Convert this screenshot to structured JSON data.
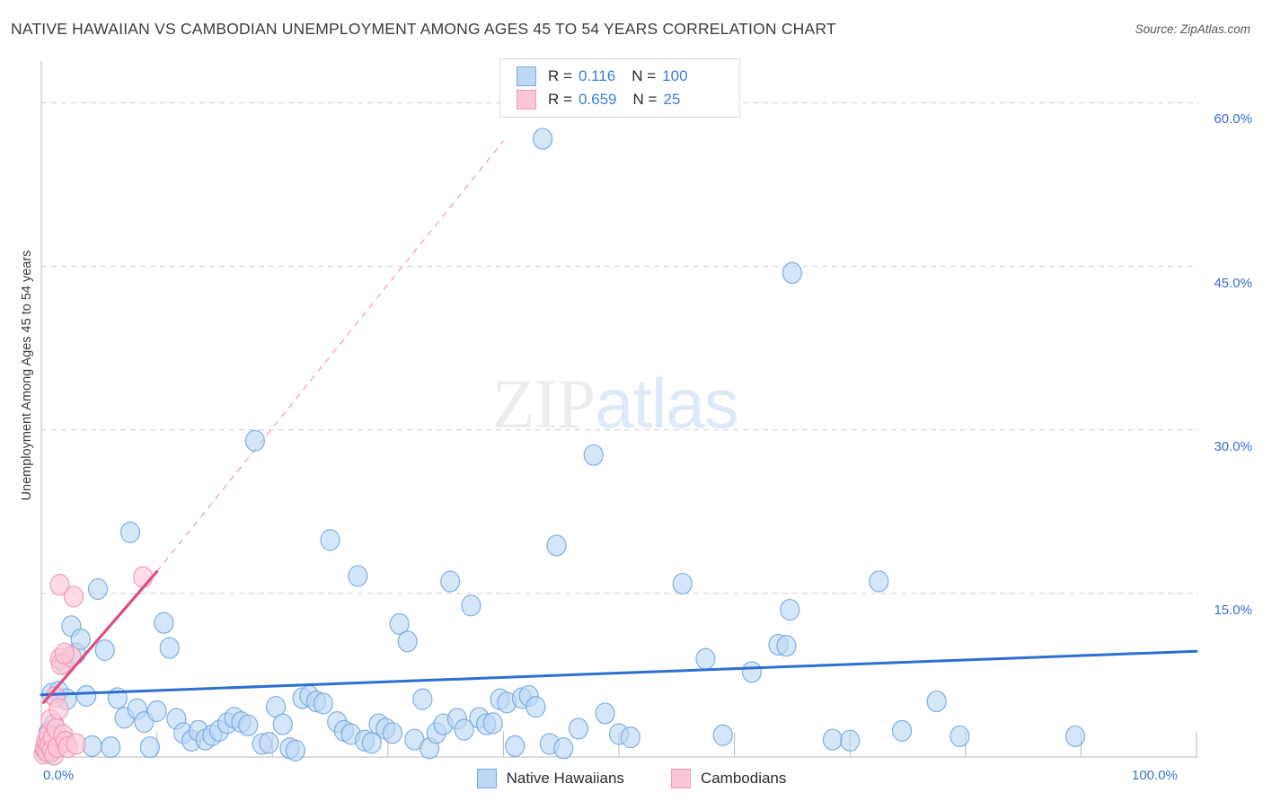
{
  "header": {
    "title": "NATIVE HAWAIIAN VS CAMBODIAN UNEMPLOYMENT AMONG AGES 45 TO 54 YEARS CORRELATION CHART",
    "source": "Source: ZipAtlas.com"
  },
  "watermark": {
    "part1": "ZIP",
    "part2": "atlas"
  },
  "legend_box": {
    "rows": [
      {
        "color": "#bdd7f5",
        "r_label": "R =",
        "r_value": "0.116",
        "n_label": "N =",
        "n_value": "100"
      },
      {
        "color": "#fbc7d7",
        "r_label": "R =",
        "r_value": "0.659",
        "n_label": "N =",
        "n_value": "25"
      }
    ]
  },
  "bottom_legend": [
    {
      "label": "Native Hawaiians",
      "color": "#bdd7f5"
    },
    {
      "label": "Cambodians",
      "color": "#fbc7d7"
    }
  ],
  "chart_data": {
    "type": "scatter",
    "title": "NATIVE HAWAIIAN VS CAMBODIAN UNEMPLOYMENT AMONG AGES 45 TO 54 YEARS CORRELATION CHART",
    "xlabel": "",
    "ylabel": "Unemployment Among Ages 45 to 54 years",
    "xlim": [
      0,
      100
    ],
    "ylim": [
      0,
      63.5
    ],
    "grid": true,
    "x_ticks": [
      0,
      100
    ],
    "x_tick_labels": [
      "0.0%",
      "100.0%"
    ],
    "y_ticks": [
      15,
      30,
      45,
      60
    ],
    "y_tick_labels": [
      "15.0%",
      "30.0%",
      "45.0%",
      "60.0%"
    ],
    "legend_position": "bottom",
    "series": [
      {
        "name": "Native Hawaiians",
        "color": "#bdd7f5",
        "edge_color": "#6fa3dd",
        "r": 0.116,
        "n": 100,
        "trendline": {
          "x1": 0,
          "y1": 5.7,
          "x2": 100,
          "y2": 9.7,
          "color": "#2b6fd0",
          "style": "solid"
        },
        "points": [
          [
            0.3,
            0.6
          ],
          [
            0.5,
            1.2
          ],
          [
            0.6,
            2.2
          ],
          [
            0.8,
            0.4
          ],
          [
            0.9,
            5.8
          ],
          [
            1.1,
            3.0
          ],
          [
            1.3,
            1.5
          ],
          [
            1.5,
            6.0
          ],
          [
            2.0,
            8.6
          ],
          [
            2.2,
            5.3
          ],
          [
            2.6,
            12.0
          ],
          [
            3.0,
            9.5
          ],
          [
            3.4,
            10.8
          ],
          [
            3.9,
            5.6
          ],
          [
            4.4,
            1.0
          ],
          [
            4.9,
            15.4
          ],
          [
            5.5,
            9.8
          ],
          [
            6.0,
            0.9
          ],
          [
            6.6,
            5.4
          ],
          [
            7.2,
            3.6
          ],
          [
            7.7,
            20.6
          ],
          [
            8.3,
            4.4
          ],
          [
            8.9,
            3.2
          ],
          [
            9.4,
            0.9
          ],
          [
            10.0,
            4.2
          ],
          [
            10.6,
            12.3
          ],
          [
            11.1,
            10.0
          ],
          [
            11.7,
            3.5
          ],
          [
            12.3,
            2.2
          ],
          [
            13.0,
            1.5
          ],
          [
            13.6,
            2.4
          ],
          [
            14.2,
            1.6
          ],
          [
            14.8,
            2.0
          ],
          [
            15.4,
            2.4
          ],
          [
            16.1,
            3.1
          ],
          [
            16.7,
            3.6
          ],
          [
            17.3,
            3.2
          ],
          [
            17.9,
            2.9
          ],
          [
            18.5,
            29.0
          ],
          [
            19.1,
            1.2
          ],
          [
            19.7,
            1.3
          ],
          [
            20.3,
            4.6
          ],
          [
            20.9,
            3.0
          ],
          [
            21.5,
            0.8
          ],
          [
            22.0,
            0.6
          ],
          [
            22.6,
            5.4
          ],
          [
            23.2,
            5.6
          ],
          [
            23.8,
            5.1
          ],
          [
            24.4,
            4.9
          ],
          [
            25.0,
            19.9
          ],
          [
            25.6,
            3.2
          ],
          [
            26.2,
            2.4
          ],
          [
            26.8,
            2.1
          ],
          [
            27.4,
            16.6
          ],
          [
            28.0,
            1.5
          ],
          [
            28.6,
            1.3
          ],
          [
            29.2,
            3.0
          ],
          [
            29.8,
            2.6
          ],
          [
            30.4,
            2.2
          ],
          [
            31.0,
            12.2
          ],
          [
            31.7,
            10.6
          ],
          [
            32.3,
            1.6
          ],
          [
            33.0,
            5.3
          ],
          [
            33.6,
            0.8
          ],
          [
            34.2,
            2.2
          ],
          [
            34.8,
            3.0
          ],
          [
            35.4,
            16.1
          ],
          [
            36.0,
            3.5
          ],
          [
            36.6,
            2.5
          ],
          [
            37.2,
            13.9
          ],
          [
            37.9,
            3.6
          ],
          [
            38.5,
            3.0
          ],
          [
            39.1,
            3.1
          ],
          [
            39.7,
            5.3
          ],
          [
            40.3,
            5.0
          ],
          [
            41.0,
            1.0
          ],
          [
            41.6,
            5.4
          ],
          [
            42.2,
            5.6
          ],
          [
            42.8,
            4.6
          ],
          [
            43.4,
            56.7
          ],
          [
            44.0,
            1.2
          ],
          [
            44.6,
            19.4
          ],
          [
            45.2,
            0.8
          ],
          [
            46.5,
            2.6
          ],
          [
            47.8,
            27.7
          ],
          [
            48.8,
            4.0
          ],
          [
            50.0,
            2.1
          ],
          [
            51.0,
            1.8
          ],
          [
            55.5,
            15.9
          ],
          [
            57.5,
            9.0
          ],
          [
            59.0,
            2.0
          ],
          [
            61.5,
            7.8
          ],
          [
            63.8,
            10.3
          ],
          [
            64.5,
            10.2
          ],
          [
            64.8,
            13.5
          ],
          [
            65.0,
            44.4
          ],
          [
            68.5,
            1.6
          ],
          [
            70.0,
            1.5
          ],
          [
            72.5,
            16.1
          ],
          [
            74.5,
            2.4
          ],
          [
            77.5,
            5.1
          ],
          [
            79.5,
            1.9
          ],
          [
            89.5,
            1.9
          ]
        ]
      },
      {
        "name": "Cambodians",
        "color": "#fbc7d7",
        "edge_color": "#f191ae",
        "r": 0.659,
        "n": 25,
        "trendline": {
          "x1": 0.2,
          "y1": 5.0,
          "x2": 10.0,
          "y2": 17.0,
          "color": "#dd4f7e",
          "style": "solid"
        },
        "trendline_extension": {
          "x1": 10.0,
          "y1": 17.0,
          "x2": 40.0,
          "y2": 56.5,
          "color": "#f2a0bb",
          "style": "dashed"
        },
        "points": [
          [
            0.2,
            0.3
          ],
          [
            0.3,
            0.8
          ],
          [
            0.4,
            1.4
          ],
          [
            0.5,
            0.5
          ],
          [
            0.6,
            2.0
          ],
          [
            0.7,
            1.1
          ],
          [
            0.8,
            3.4
          ],
          [
            0.9,
            0.6
          ],
          [
            1.0,
            1.8
          ],
          [
            1.1,
            0.2
          ],
          [
            1.2,
            5.5
          ],
          [
            1.3,
            2.6
          ],
          [
            1.4,
            0.9
          ],
          [
            1.5,
            4.4
          ],
          [
            1.6,
            9.0
          ],
          [
            1.7,
            8.5
          ],
          [
            1.9,
            2.0
          ],
          [
            2.1,
            1.4
          ],
          [
            2.3,
            0.9
          ],
          [
            2.6,
            9.2
          ],
          [
            3.0,
            1.2
          ],
          [
            1.6,
            15.8
          ],
          [
            2.8,
            14.7
          ],
          [
            2.0,
            9.5
          ],
          [
            8.8,
            16.5
          ]
        ]
      }
    ]
  }
}
